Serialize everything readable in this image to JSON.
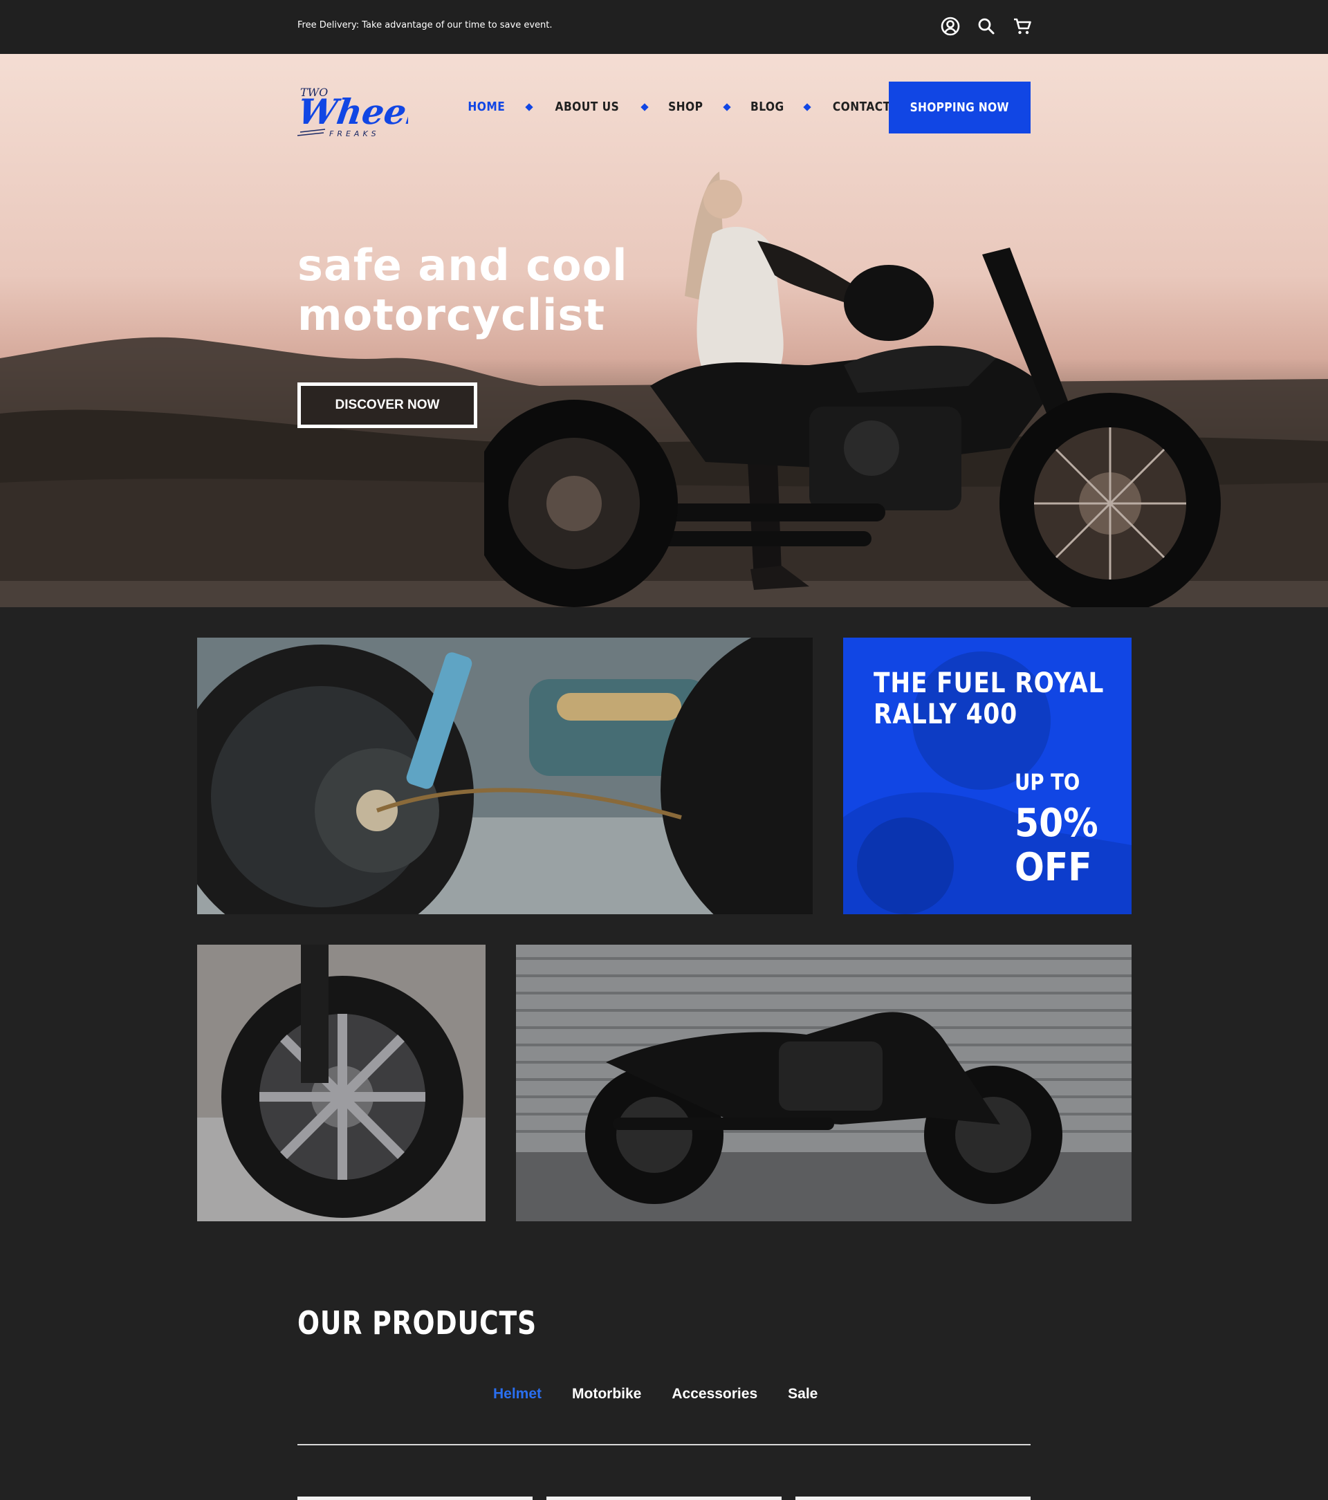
{
  "topbar": {
    "promo_text": "Free Delivery: Take advantage of our time to save event.",
    "icons": [
      "account-icon",
      "search-icon",
      "cart-icon"
    ]
  },
  "header": {
    "logo_text": "TWO WHEELS FREAKS",
    "nav": [
      {
        "label": "HOME",
        "active": true
      },
      {
        "label": "ABOUT US",
        "active": false
      },
      {
        "label": "SHOP",
        "active": false
      },
      {
        "label": "BLOG",
        "active": false
      },
      {
        "label": "CONTACT",
        "active": false
      }
    ],
    "cta_label": "SHOPPING NOW"
  },
  "hero": {
    "title_line1": "safe and cool",
    "title_line2": "motorcyclist",
    "button_label": "DISCOVER NOW"
  },
  "promo": {
    "title_line1": "THE FUEL ROYAL",
    "title_line2": "RALLY 400",
    "upto": "UP TO",
    "percent": "50%",
    "off": "OFF"
  },
  "products": {
    "title": "OUR PRODUCTS",
    "tabs": [
      {
        "label": "Helmet",
        "active": true
      },
      {
        "label": "Motorbike",
        "active": false
      },
      {
        "label": "Accessories",
        "active": false
      },
      {
        "label": "Sale",
        "active": false
      }
    ]
  },
  "colors": {
    "accent": "#1146e4",
    "background": "#222222",
    "text_light": "#ffffff",
    "tab_active": "#2a6ff0"
  }
}
